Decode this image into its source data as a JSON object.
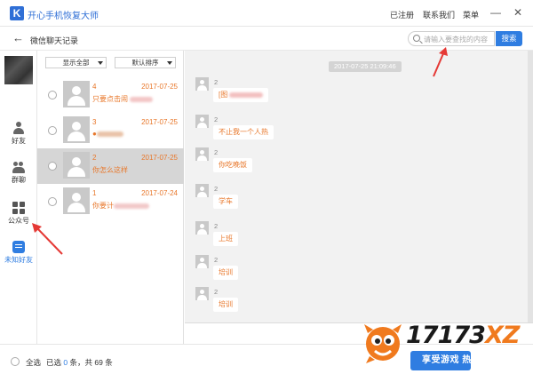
{
  "titlebar": {
    "logo_letter": "K",
    "app_title": "开心手机恢复大师",
    "registered": "已注册",
    "contact_us": "联系我们",
    "menu": "菜单",
    "minimize": "—",
    "close": "✕"
  },
  "subbar": {
    "back": "←",
    "title": "微信聊天记录",
    "search_placeholder": "请输入要查找的内容",
    "search_button": "搜索"
  },
  "sidebar": {
    "items": [
      {
        "label": "好友",
        "icon": "person-icon"
      },
      {
        "label": "群聊",
        "icon": "group-icon"
      },
      {
        "label": "公众号",
        "icon": "grid-icon"
      },
      {
        "label": "未知好友",
        "icon": "chat-icon"
      }
    ]
  },
  "list": {
    "filter_show": "显示全部",
    "filter_sort": "默认排序",
    "contacts": [
      {
        "name": "4",
        "date": "2017-07-25",
        "message": "只要点击闹"
      },
      {
        "name": "3",
        "date": "2017-07-25",
        "message": "●"
      },
      {
        "name": "2",
        "date": "2017-07-25",
        "message": "你怎么这样"
      },
      {
        "name": "1",
        "date": "2017-07-24",
        "message": "你要计"
      }
    ]
  },
  "chat": {
    "timestamp": "2017-07-25 21:09:46",
    "messages": [
      {
        "sender": "2",
        "text": "[图"
      },
      {
        "sender": "2",
        "text": "不止我一个人热"
      },
      {
        "sender": "2",
        "text": "你吃晚饭"
      },
      {
        "sender": "2",
        "text": "学车"
      },
      {
        "sender": "2",
        "text": "上班"
      },
      {
        "sender": "2",
        "text": "培训"
      },
      {
        "sender": "2",
        "text": "培训"
      }
    ]
  },
  "footer": {
    "select_all": "全选",
    "selected_prefix": "已选",
    "selected_count": "0",
    "selected_mid": "条，共",
    "total_count": "69",
    "selected_suffix": "条"
  },
  "watermark": {
    "logo_main": "17173",
    "logo_accent": "XZ",
    "slogan": "享受游戏 热爱生活！"
  },
  "colors": {
    "accent_blue": "#2f7de1",
    "orange_text": "#e8772a",
    "annotation_red": "#e53935"
  }
}
